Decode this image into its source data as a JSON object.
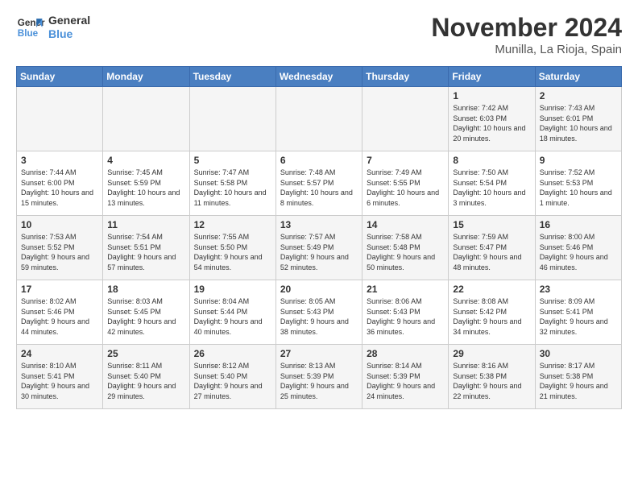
{
  "logo": {
    "line1": "General",
    "line2": "Blue"
  },
  "header": {
    "month": "November 2024",
    "location": "Munilla, La Rioja, Spain"
  },
  "days_of_week": [
    "Sunday",
    "Monday",
    "Tuesday",
    "Wednesday",
    "Thursday",
    "Friday",
    "Saturday"
  ],
  "weeks": [
    [
      {
        "day": "",
        "info": ""
      },
      {
        "day": "",
        "info": ""
      },
      {
        "day": "",
        "info": ""
      },
      {
        "day": "",
        "info": ""
      },
      {
        "day": "",
        "info": ""
      },
      {
        "day": "1",
        "info": "Sunrise: 7:42 AM\nSunset: 6:03 PM\nDaylight: 10 hours and 20 minutes."
      },
      {
        "day": "2",
        "info": "Sunrise: 7:43 AM\nSunset: 6:01 PM\nDaylight: 10 hours and 18 minutes."
      }
    ],
    [
      {
        "day": "3",
        "info": "Sunrise: 7:44 AM\nSunset: 6:00 PM\nDaylight: 10 hours and 15 minutes."
      },
      {
        "day": "4",
        "info": "Sunrise: 7:45 AM\nSunset: 5:59 PM\nDaylight: 10 hours and 13 minutes."
      },
      {
        "day": "5",
        "info": "Sunrise: 7:47 AM\nSunset: 5:58 PM\nDaylight: 10 hours and 11 minutes."
      },
      {
        "day": "6",
        "info": "Sunrise: 7:48 AM\nSunset: 5:57 PM\nDaylight: 10 hours and 8 minutes."
      },
      {
        "day": "7",
        "info": "Sunrise: 7:49 AM\nSunset: 5:55 PM\nDaylight: 10 hours and 6 minutes."
      },
      {
        "day": "8",
        "info": "Sunrise: 7:50 AM\nSunset: 5:54 PM\nDaylight: 10 hours and 3 minutes."
      },
      {
        "day": "9",
        "info": "Sunrise: 7:52 AM\nSunset: 5:53 PM\nDaylight: 10 hours and 1 minute."
      }
    ],
    [
      {
        "day": "10",
        "info": "Sunrise: 7:53 AM\nSunset: 5:52 PM\nDaylight: 9 hours and 59 minutes."
      },
      {
        "day": "11",
        "info": "Sunrise: 7:54 AM\nSunset: 5:51 PM\nDaylight: 9 hours and 57 minutes."
      },
      {
        "day": "12",
        "info": "Sunrise: 7:55 AM\nSunset: 5:50 PM\nDaylight: 9 hours and 54 minutes."
      },
      {
        "day": "13",
        "info": "Sunrise: 7:57 AM\nSunset: 5:49 PM\nDaylight: 9 hours and 52 minutes."
      },
      {
        "day": "14",
        "info": "Sunrise: 7:58 AM\nSunset: 5:48 PM\nDaylight: 9 hours and 50 minutes."
      },
      {
        "day": "15",
        "info": "Sunrise: 7:59 AM\nSunset: 5:47 PM\nDaylight: 9 hours and 48 minutes."
      },
      {
        "day": "16",
        "info": "Sunrise: 8:00 AM\nSunset: 5:46 PM\nDaylight: 9 hours and 46 minutes."
      }
    ],
    [
      {
        "day": "17",
        "info": "Sunrise: 8:02 AM\nSunset: 5:46 PM\nDaylight: 9 hours and 44 minutes."
      },
      {
        "day": "18",
        "info": "Sunrise: 8:03 AM\nSunset: 5:45 PM\nDaylight: 9 hours and 42 minutes."
      },
      {
        "day": "19",
        "info": "Sunrise: 8:04 AM\nSunset: 5:44 PM\nDaylight: 9 hours and 40 minutes."
      },
      {
        "day": "20",
        "info": "Sunrise: 8:05 AM\nSunset: 5:43 PM\nDaylight: 9 hours and 38 minutes."
      },
      {
        "day": "21",
        "info": "Sunrise: 8:06 AM\nSunset: 5:43 PM\nDaylight: 9 hours and 36 minutes."
      },
      {
        "day": "22",
        "info": "Sunrise: 8:08 AM\nSunset: 5:42 PM\nDaylight: 9 hours and 34 minutes."
      },
      {
        "day": "23",
        "info": "Sunrise: 8:09 AM\nSunset: 5:41 PM\nDaylight: 9 hours and 32 minutes."
      }
    ],
    [
      {
        "day": "24",
        "info": "Sunrise: 8:10 AM\nSunset: 5:41 PM\nDaylight: 9 hours and 30 minutes."
      },
      {
        "day": "25",
        "info": "Sunrise: 8:11 AM\nSunset: 5:40 PM\nDaylight: 9 hours and 29 minutes."
      },
      {
        "day": "26",
        "info": "Sunrise: 8:12 AM\nSunset: 5:40 PM\nDaylight: 9 hours and 27 minutes."
      },
      {
        "day": "27",
        "info": "Sunrise: 8:13 AM\nSunset: 5:39 PM\nDaylight: 9 hours and 25 minutes."
      },
      {
        "day": "28",
        "info": "Sunrise: 8:14 AM\nSunset: 5:39 PM\nDaylight: 9 hours and 24 minutes."
      },
      {
        "day": "29",
        "info": "Sunrise: 8:16 AM\nSunset: 5:38 PM\nDaylight: 9 hours and 22 minutes."
      },
      {
        "day": "30",
        "info": "Sunrise: 8:17 AM\nSunset: 5:38 PM\nDaylight: 9 hours and 21 minutes."
      }
    ]
  ]
}
